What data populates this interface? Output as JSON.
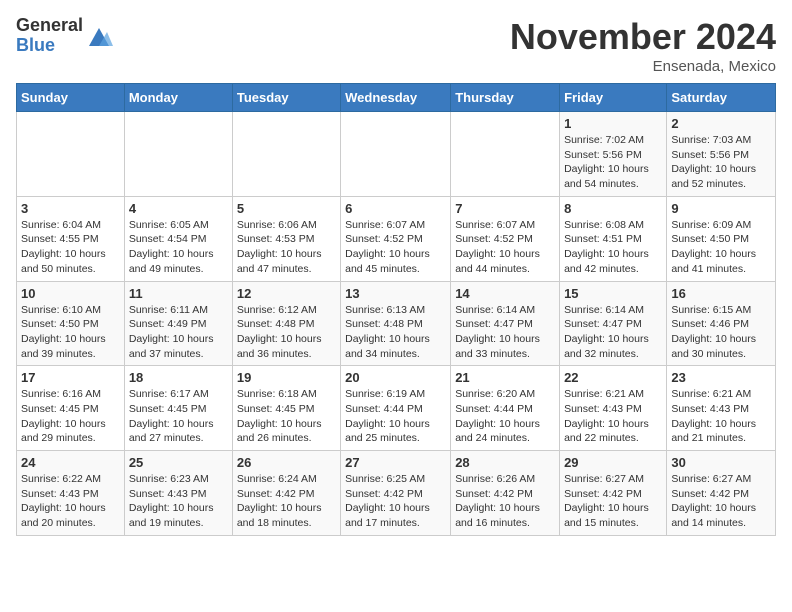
{
  "logo": {
    "general": "General",
    "blue": "Blue"
  },
  "title": "November 2024",
  "location": "Ensenada, Mexico",
  "headers": [
    "Sunday",
    "Monday",
    "Tuesday",
    "Wednesday",
    "Thursday",
    "Friday",
    "Saturday"
  ],
  "weeks": [
    [
      {
        "day": "",
        "info": ""
      },
      {
        "day": "",
        "info": ""
      },
      {
        "day": "",
        "info": ""
      },
      {
        "day": "",
        "info": ""
      },
      {
        "day": "",
        "info": ""
      },
      {
        "day": "1",
        "info": "Sunrise: 7:02 AM\nSunset: 5:56 PM\nDaylight: 10 hours\nand 54 minutes."
      },
      {
        "day": "2",
        "info": "Sunrise: 7:03 AM\nSunset: 5:56 PM\nDaylight: 10 hours\nand 52 minutes."
      }
    ],
    [
      {
        "day": "3",
        "info": "Sunrise: 6:04 AM\nSunset: 4:55 PM\nDaylight: 10 hours\nand 50 minutes."
      },
      {
        "day": "4",
        "info": "Sunrise: 6:05 AM\nSunset: 4:54 PM\nDaylight: 10 hours\nand 49 minutes."
      },
      {
        "day": "5",
        "info": "Sunrise: 6:06 AM\nSunset: 4:53 PM\nDaylight: 10 hours\nand 47 minutes."
      },
      {
        "day": "6",
        "info": "Sunrise: 6:07 AM\nSunset: 4:52 PM\nDaylight: 10 hours\nand 45 minutes."
      },
      {
        "day": "7",
        "info": "Sunrise: 6:07 AM\nSunset: 4:52 PM\nDaylight: 10 hours\nand 44 minutes."
      },
      {
        "day": "8",
        "info": "Sunrise: 6:08 AM\nSunset: 4:51 PM\nDaylight: 10 hours\nand 42 minutes."
      },
      {
        "day": "9",
        "info": "Sunrise: 6:09 AM\nSunset: 4:50 PM\nDaylight: 10 hours\nand 41 minutes."
      }
    ],
    [
      {
        "day": "10",
        "info": "Sunrise: 6:10 AM\nSunset: 4:50 PM\nDaylight: 10 hours\nand 39 minutes."
      },
      {
        "day": "11",
        "info": "Sunrise: 6:11 AM\nSunset: 4:49 PM\nDaylight: 10 hours\nand 37 minutes."
      },
      {
        "day": "12",
        "info": "Sunrise: 6:12 AM\nSunset: 4:48 PM\nDaylight: 10 hours\nand 36 minutes."
      },
      {
        "day": "13",
        "info": "Sunrise: 6:13 AM\nSunset: 4:48 PM\nDaylight: 10 hours\nand 34 minutes."
      },
      {
        "day": "14",
        "info": "Sunrise: 6:14 AM\nSunset: 4:47 PM\nDaylight: 10 hours\nand 33 minutes."
      },
      {
        "day": "15",
        "info": "Sunrise: 6:14 AM\nSunset: 4:47 PM\nDaylight: 10 hours\nand 32 minutes."
      },
      {
        "day": "16",
        "info": "Sunrise: 6:15 AM\nSunset: 4:46 PM\nDaylight: 10 hours\nand 30 minutes."
      }
    ],
    [
      {
        "day": "17",
        "info": "Sunrise: 6:16 AM\nSunset: 4:45 PM\nDaylight: 10 hours\nand 29 minutes."
      },
      {
        "day": "18",
        "info": "Sunrise: 6:17 AM\nSunset: 4:45 PM\nDaylight: 10 hours\nand 27 minutes."
      },
      {
        "day": "19",
        "info": "Sunrise: 6:18 AM\nSunset: 4:45 PM\nDaylight: 10 hours\nand 26 minutes."
      },
      {
        "day": "20",
        "info": "Sunrise: 6:19 AM\nSunset: 4:44 PM\nDaylight: 10 hours\nand 25 minutes."
      },
      {
        "day": "21",
        "info": "Sunrise: 6:20 AM\nSunset: 4:44 PM\nDaylight: 10 hours\nand 24 minutes."
      },
      {
        "day": "22",
        "info": "Sunrise: 6:21 AM\nSunset: 4:43 PM\nDaylight: 10 hours\nand 22 minutes."
      },
      {
        "day": "23",
        "info": "Sunrise: 6:21 AM\nSunset: 4:43 PM\nDaylight: 10 hours\nand 21 minutes."
      }
    ],
    [
      {
        "day": "24",
        "info": "Sunrise: 6:22 AM\nSunset: 4:43 PM\nDaylight: 10 hours\nand 20 minutes."
      },
      {
        "day": "25",
        "info": "Sunrise: 6:23 AM\nSunset: 4:43 PM\nDaylight: 10 hours\nand 19 minutes."
      },
      {
        "day": "26",
        "info": "Sunrise: 6:24 AM\nSunset: 4:42 PM\nDaylight: 10 hours\nand 18 minutes."
      },
      {
        "day": "27",
        "info": "Sunrise: 6:25 AM\nSunset: 4:42 PM\nDaylight: 10 hours\nand 17 minutes."
      },
      {
        "day": "28",
        "info": "Sunrise: 6:26 AM\nSunset: 4:42 PM\nDaylight: 10 hours\nand 16 minutes."
      },
      {
        "day": "29",
        "info": "Sunrise: 6:27 AM\nSunset: 4:42 PM\nDaylight: 10 hours\nand 15 minutes."
      },
      {
        "day": "30",
        "info": "Sunrise: 6:27 AM\nSunset: 4:42 PM\nDaylight: 10 hours\nand 14 minutes."
      }
    ]
  ]
}
